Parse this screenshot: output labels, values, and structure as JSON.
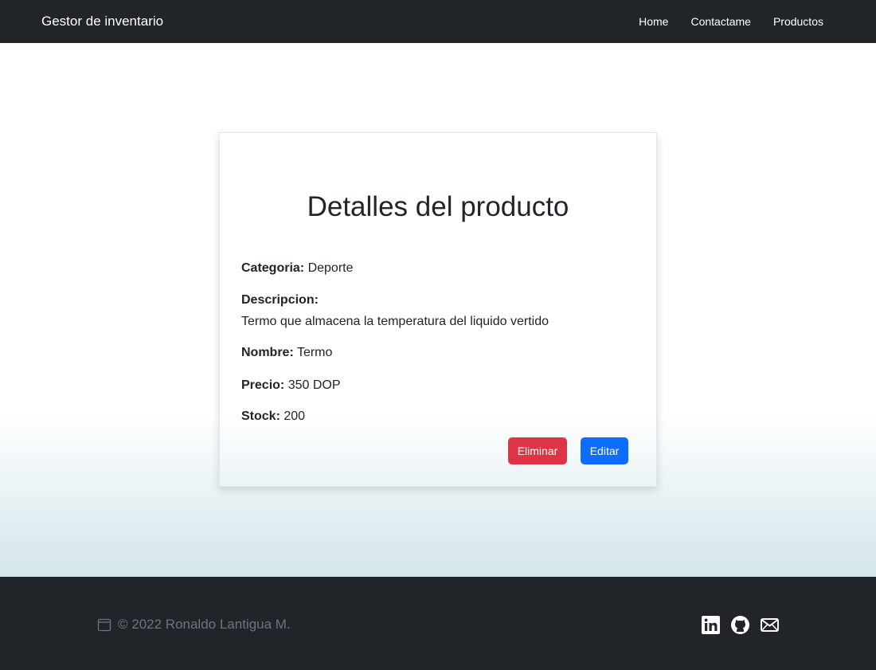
{
  "navbar": {
    "brand": "Gestor de inventario",
    "links": [
      "Home",
      "Contactame",
      "Productos"
    ]
  },
  "card": {
    "title": "Detalles del producto",
    "fields": {
      "categoria_label": "Categoria:",
      "categoria_value": "Deporte",
      "descripcion_label": "Descripcion:",
      "descripcion_value": "Termo que almacena la temperatura del liquido vertido",
      "nombre_label": "Nombre:",
      "nombre_value": "Termo",
      "precio_label": "Precio:",
      "precio_value": "350 DOP",
      "stock_label": "Stock:",
      "stock_value": "200"
    },
    "buttons": {
      "delete": "Eliminar",
      "edit": "Editar"
    }
  },
  "footer": {
    "copyright": "© 2022 Ronaldo Lantigua M.",
    "icons": [
      "calendar-icon",
      "linkedin-icon",
      "github-icon",
      "envelope-icon"
    ]
  },
  "colors": {
    "navbar_bg": "#212529",
    "delete_button": "#dc3545",
    "edit_button": "#0d6efd",
    "footer_text": "#6c757d"
  }
}
